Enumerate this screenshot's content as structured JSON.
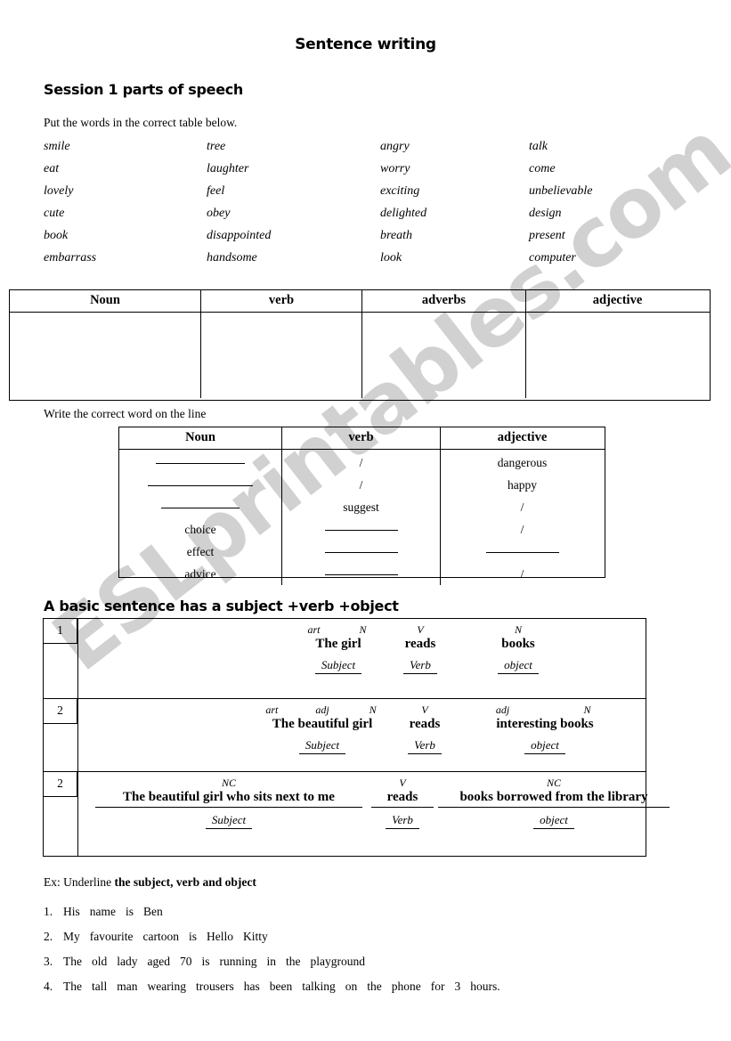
{
  "document": {
    "title": "Sentence writing",
    "session_heading": "Session 1 parts of speech",
    "basic_sentence_heading": "A basic sentence has a subject +verb +object",
    "instruction_sort": "Put the words in the correct table below.",
    "instruction_write": "Write the correct word on the line"
  },
  "watermark": {
    "text": "ESLprintables.com",
    "color": "#c9c9c9"
  },
  "word_list": {
    "columns": [
      [
        "smile",
        "eat",
        "lovely",
        "cute",
        "book",
        "embarrass"
      ],
      [
        "tree",
        "laughter",
        "feel",
        "obey",
        "disappointed",
        "handsome"
      ],
      [
        "angry",
        "worry",
        "exciting",
        "delighted",
        "breath",
        "look"
      ],
      [
        "talk",
        "come",
        "unbelievable",
        "design",
        "present",
        "computer"
      ]
    ]
  },
  "table_parts_of_speech": {
    "headers": [
      "Noun",
      "verb",
      "adverbs",
      "adjective"
    ],
    "rows": [
      [
        "",
        "",
        "",
        ""
      ]
    ]
  },
  "table_word_forms": {
    "headers": [
      "Noun",
      "verb",
      "adjective"
    ],
    "columns": {
      "noun": [
        "____________",
        "_____________",
        "__________",
        "choice",
        "effect",
        "advice"
      ],
      "verb": [
        "/",
        "/",
        "suggest",
        "__________",
        "__________",
        "__________"
      ],
      "adjective": [
        "dangerous",
        "happy",
        "/",
        "/",
        "__________",
        "/"
      ]
    }
  },
  "sentence_table": {
    "rows": [
      {
        "number": "1",
        "chunks": [
          {
            "tags": [
              "art",
              "N"
            ],
            "phrase": "The girl",
            "role": "Subject",
            "underlined": false
          },
          {
            "tags": [
              "V"
            ],
            "phrase": "reads",
            "role": "Verb",
            "underlined": false
          },
          {
            "tags": [
              "N"
            ],
            "phrase": "books",
            "role": "object",
            "underlined": false
          }
        ]
      },
      {
        "number": "2",
        "chunks": [
          {
            "tags": [
              "art",
              "adj",
              "N"
            ],
            "phrase": "The beautiful girl",
            "role": "Subject",
            "underlined": false
          },
          {
            "tags": [
              "V"
            ],
            "phrase": "reads",
            "role": "Verb",
            "underlined": false
          },
          {
            "tags": [
              "adj",
              "N"
            ],
            "phrase": "interesting books",
            "role": "object",
            "underlined": false
          }
        ]
      },
      {
        "number": "2",
        "chunks": [
          {
            "tags": [
              "NC"
            ],
            "phrase": "The beautiful girl who sits next to me",
            "role": "Subject",
            "underlined": true
          },
          {
            "tags": [
              "V"
            ],
            "phrase": "reads",
            "role": "Verb",
            "underlined": true
          },
          {
            "tags": [
              "NC"
            ],
            "phrase": "books borrowed from the library",
            "role": "object",
            "underlined": true
          }
        ]
      }
    ]
  },
  "exercise": {
    "heading_prefix": "Ex: Underline ",
    "heading_bold": "the subject, verb and object",
    "items": [
      {
        "number": "1.",
        "words": [
          "His",
          "name",
          "is",
          "Ben"
        ]
      },
      {
        "number": "2.",
        "words": [
          "My",
          "favourite",
          "cartoon",
          "is",
          "Hello",
          "Kitty"
        ]
      },
      {
        "number": "3.",
        "words": [
          "The",
          "old",
          "lady",
          "aged",
          "70",
          "is",
          "running",
          "in",
          "the",
          "playground"
        ]
      },
      {
        "number": "4.",
        "words": [
          "The",
          "tall",
          "man",
          "wearing",
          "trousers",
          "has",
          "been",
          "talking",
          "on",
          "the",
          "phone",
          "for",
          "3",
          "hours."
        ]
      }
    ]
  }
}
